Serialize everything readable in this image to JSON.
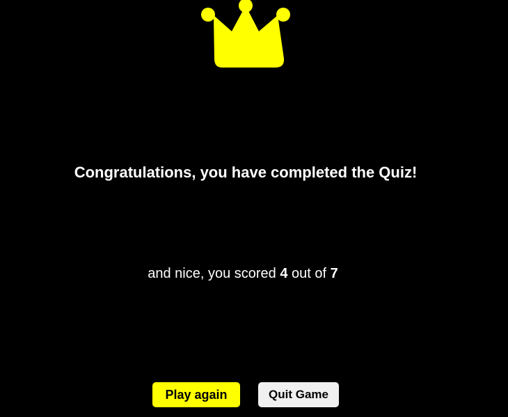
{
  "icon": "crown-icon",
  "colors": {
    "background": "#000000",
    "accent": "#ffff00",
    "text": "#ffffff",
    "secondary_button": "#f0f0f0"
  },
  "result": {
    "title": "Congratulations, you have completed the Quiz!",
    "prefix": "and nice, you scored",
    "score": "4",
    "out_of_label": "out of",
    "total": "7"
  },
  "buttons": {
    "play_again": "Play again",
    "quit_game": "Quit Game"
  }
}
